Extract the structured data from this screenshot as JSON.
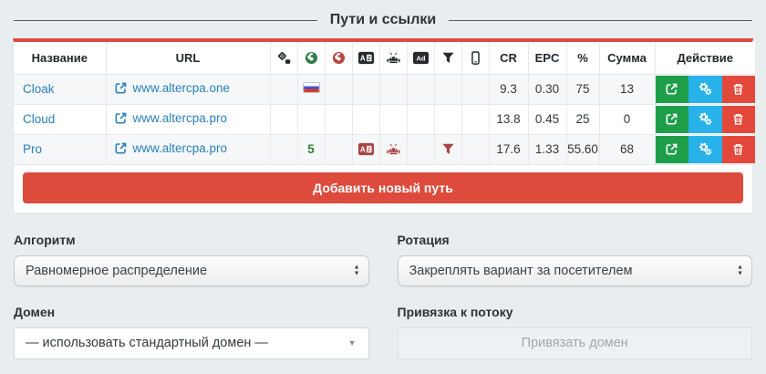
{
  "title": "Пути и ссылки",
  "table": {
    "headers": {
      "name": "Название",
      "url": "URL",
      "cr": "CR",
      "epc": "EPC",
      "percent": "%",
      "sum": "Сумма",
      "action": "Действие"
    },
    "icon_columns": [
      "split-icon",
      "geo-allow-globe-icon",
      "geo-deny-globe-icon",
      "language-icon",
      "android-icon",
      "ad-icon",
      "filter-icon",
      "mobile-icon"
    ],
    "rows": [
      {
        "name": "Cloak",
        "url": "www.altercpa.one",
        "geo": "",
        "cr": "9.3",
        "epc": "0.30",
        "percent": "75",
        "sum": "13"
      },
      {
        "name": "Cloud",
        "url": "www.altercpa.pro",
        "geo": "",
        "cr": "13.8",
        "epc": "0.45",
        "percent": "25",
        "sum": "0"
      },
      {
        "name": "Pro",
        "url": "www.altercpa.pro",
        "geo": "5",
        "cr": "17.6",
        "epc": "1.33",
        "percent": "55.60",
        "sum": "68"
      }
    ],
    "add_button_label": "Добавить новый путь"
  },
  "form": {
    "algorithm": {
      "label": "Алгоритм",
      "value": "Равномерное распределение"
    },
    "rotation": {
      "label": "Ротация",
      "value": "Закреплять вариант за посетителем"
    },
    "domain": {
      "label": "Домен",
      "value": "— использовать стандартный домен —"
    },
    "flow_binding": {
      "label": "Привязка к потоку",
      "button_label": "Привязать домен"
    }
  },
  "glyphs": {
    "up": "▲",
    "down": "▼"
  },
  "colors": {
    "accent_red": "#dc4b3c",
    "link_blue": "#2980b9",
    "action_green": "#1f9e4a",
    "action_blue": "#29b2ea",
    "action_red": "#e2493b",
    "geo_green": "#2f7d46",
    "geo_red": "#b5473f",
    "row_icon_red": "#a94442"
  }
}
